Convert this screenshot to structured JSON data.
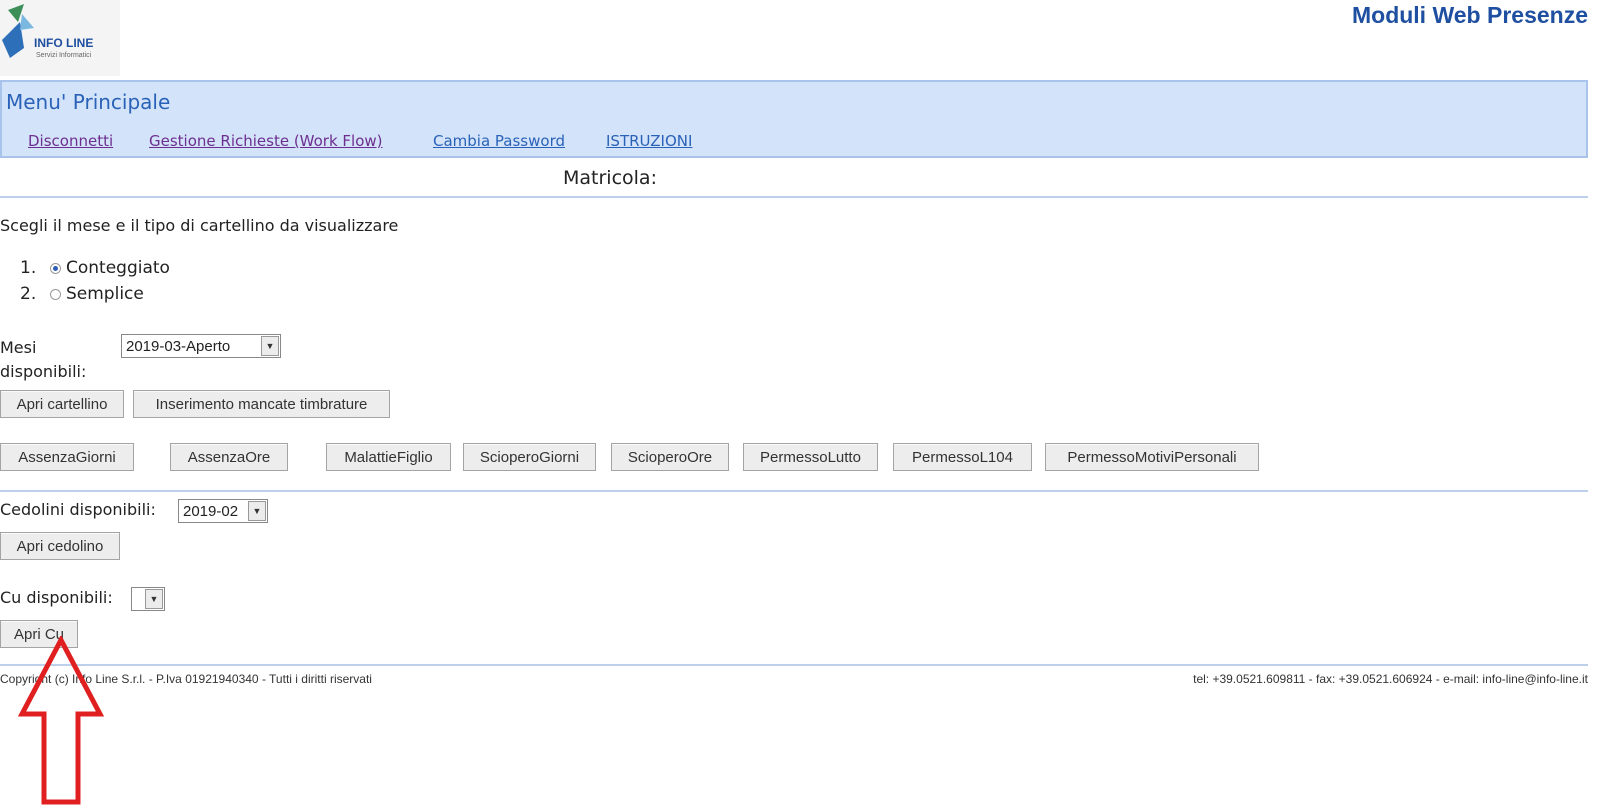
{
  "header": {
    "logo_text": "INFO LINE",
    "logo_sub": "Servizi Informatici",
    "app_title": "Moduli Web Presenze"
  },
  "menu": {
    "title": "Menu' Principale",
    "links": [
      "Disconnetti",
      "Gestione Richieste (Work Flow)",
      "Cambia Password",
      "ISTRUZIONI"
    ]
  },
  "matricola_label": "Matricola:",
  "intro_text": "Scegli il mese e il tipo di cartellino da visualizzare",
  "card_type": {
    "options": [
      {
        "num": "1.",
        "label": "Conteggiato",
        "selected": true
      },
      {
        "num": "2.",
        "label": "Semplice",
        "selected": false
      }
    ]
  },
  "mesi": {
    "label": "Mesi disponibili:",
    "selected": "2019-03-Aperto"
  },
  "buttons_row1": [
    "Apri cartellino",
    "Inserimento mancate timbrature"
  ],
  "absence_buttons": [
    "AssenzaGiorni",
    "AssenzaOre",
    "MalattieFiglio",
    "ScioperoGiorni",
    "ScioperoOre",
    "PermessoLutto",
    "PermessoL104",
    "PermessoMotiviPersonali"
  ],
  "cedolini": {
    "label": "Cedolini disponibili:",
    "selected": "2019-02",
    "button": "Apri cedolino"
  },
  "cu": {
    "label": "Cu disponibili:",
    "selected": "",
    "button": "Apri Cu"
  },
  "footer": {
    "left": "Copyright (c) Info Line S.r.l. - P.Iva 01921940340 - Tutti i diritti riservati",
    "right": "tel: +39.0521.609811 - fax: +39.0521.606924 - e-mail: info-line@info-line.it"
  },
  "colors": {
    "menu_band": "#d3e3fa",
    "title_blue": "#1f4fa0",
    "arrow_red": "#e02020"
  }
}
